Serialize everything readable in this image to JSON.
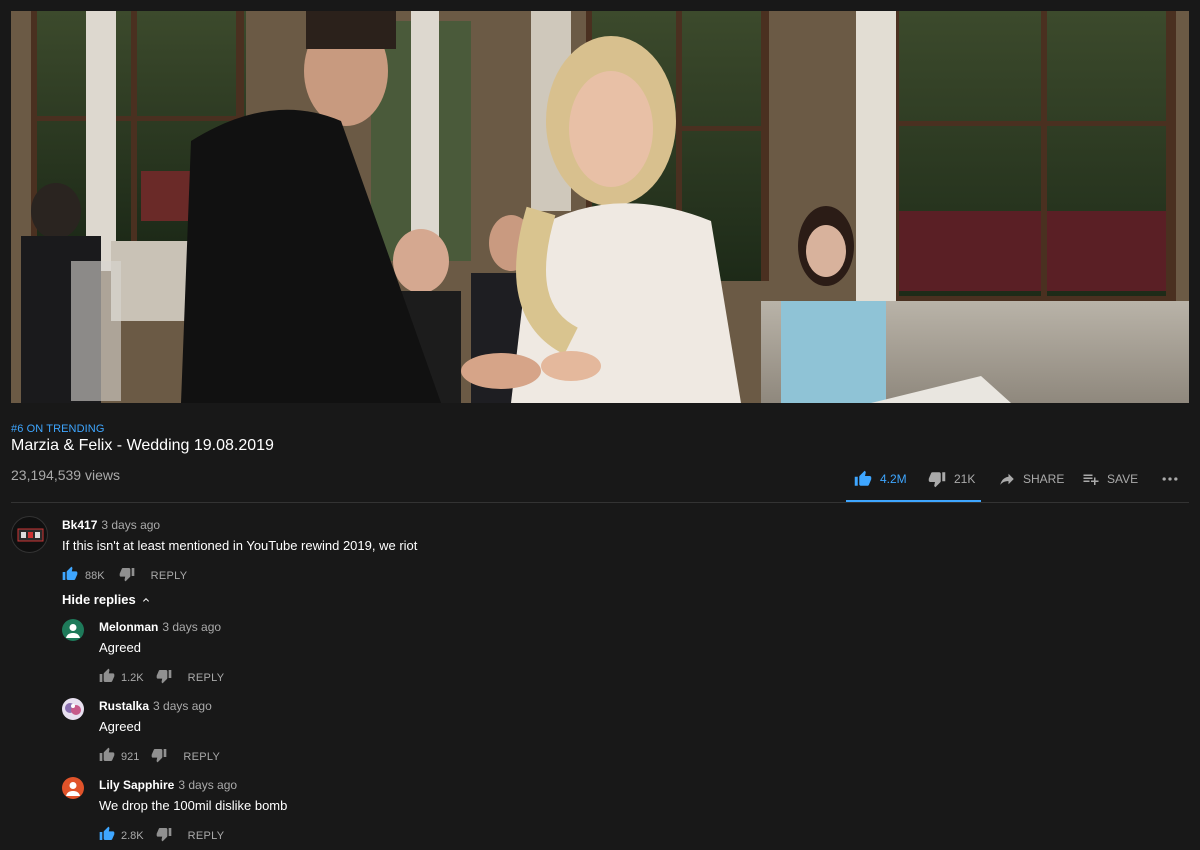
{
  "video": {
    "trending_badge": "#6 ON TRENDING",
    "title": "Marzia & Felix - Wedding 19.08.2019",
    "views": "23,194,539 views",
    "like_count": "4.2M",
    "dislike_count": "21K",
    "share_label": "SHARE",
    "save_label": "SAVE",
    "like_ratio": 0.995
  },
  "comment": {
    "author": "Bk417",
    "time": "3 days ago",
    "text": "If this isn't at least mentioned in YouTube rewind 2019, we riot",
    "likes": "88K",
    "reply_label": "REPLY",
    "liked": true
  },
  "hide_replies_label": "Hide replies",
  "replies": [
    {
      "author": "Melonman",
      "time": "3 days ago",
      "text": "Agreed",
      "likes": "1.2K",
      "reply_label": "REPLY",
      "avatar_color": "#1e7a5a",
      "liked": false
    },
    {
      "author": "Rustalka",
      "time": "3 days ago",
      "text": "Agreed",
      "likes": "921",
      "reply_label": "REPLY",
      "avatar_color": "#8a6fb0",
      "liked": false
    },
    {
      "author": "Lily Sapphire",
      "time": "3 days ago",
      "text": "We drop the 100mil dislike bomb",
      "likes": "2.8K",
      "reply_label": "REPLY",
      "avatar_color": "#e0532a",
      "liked": true
    }
  ],
  "colors": {
    "accent": "#3ea6ff",
    "background": "#181818",
    "secondary_text": "#aaaaaa"
  }
}
